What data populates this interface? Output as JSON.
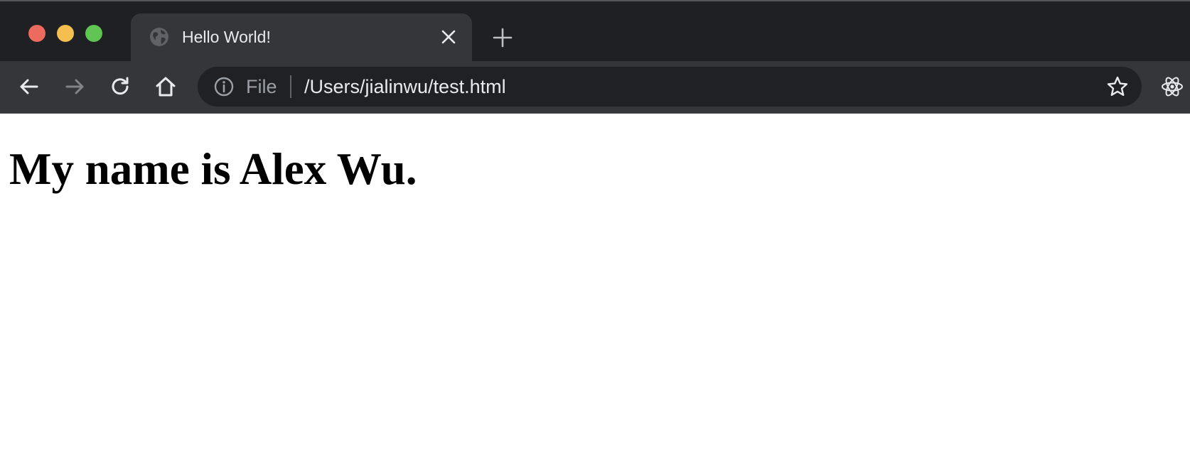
{
  "window": {
    "traffic_lights": {
      "close_color": "#ec6a5e",
      "minimize_color": "#f4bf4f",
      "maximize_color": "#61c554"
    }
  },
  "tabs": [
    {
      "title": "Hello World!",
      "favicon": "globe-icon",
      "active": true
    }
  ],
  "toolbar": {
    "back_icon": "arrow-left-icon",
    "forward_icon": "arrow-right-icon",
    "reload_icon": "reload-icon",
    "home_icon": "home-icon",
    "extension_icon": "react-icon"
  },
  "omnibox": {
    "info_icon": "info-icon",
    "scheme_label": "File",
    "url": "/Users/jialinwu/test.html",
    "bookmark_icon": "star-icon"
  },
  "page": {
    "heading": "My name is Alex Wu."
  }
}
